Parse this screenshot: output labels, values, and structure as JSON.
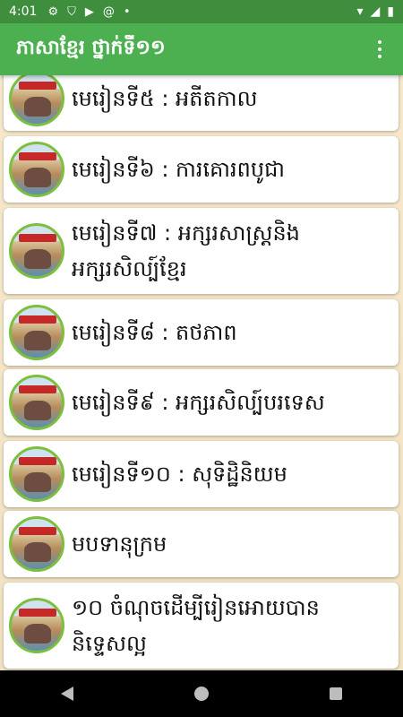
{
  "status_bar": {
    "time": "4:01",
    "icons": [
      "settings-icon",
      "shield-icon",
      "play-store-icon",
      "at-sign-icon",
      "dot-icon",
      "wifi-icon",
      "signal-icon",
      "battery-icon"
    ]
  },
  "app_bar": {
    "title": "ភាសាខ្មែរ ថ្នាក់ទី១១",
    "menu_icon": "more-vert-icon"
  },
  "lessons": [
    {
      "label": "មេរៀនទី៥ : អតីតកាល"
    },
    {
      "label": "មេរៀនទី៦ : ការគោរពបូជា"
    },
    {
      "label": "មេរៀនទី៧ : អក្សរសាស្ត្រនិង",
      "label2": "អក្សរសិល្ប៍ខ្មែរ"
    },
    {
      "label": "មេរៀនទី៨ : តថភាព"
    },
    {
      "label": "មេរៀនទី៩ : អក្សរសិល្ប៍បរទេស"
    },
    {
      "label": "មេរៀនទី១០ : សុទិដ្ឋិនិយម"
    },
    {
      "label": "មបទានុក្រម"
    },
    {
      "label": "១០ ចំណុចដើម្បីរៀនអោយបាន",
      "label2": "និទ្ទេសល្អ"
    }
  ],
  "nav_bar": {
    "icons": [
      "back-icon",
      "home-icon",
      "recents-icon"
    ]
  },
  "colors": {
    "status_bar": "#3e8e3e",
    "app_bar": "#4caf50",
    "background": "#f3e6c8",
    "thumb_border": "#7cbf3e"
  }
}
